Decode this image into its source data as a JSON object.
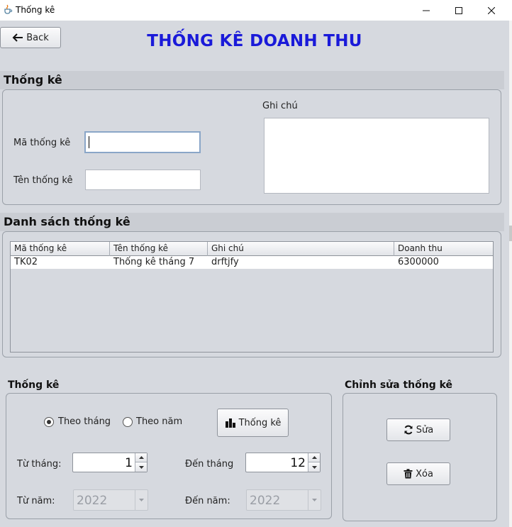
{
  "window": {
    "title": "Thống kê",
    "icon": "java-cup-icon",
    "controls": [
      "minimize-icon",
      "maximize-icon",
      "close-icon"
    ]
  },
  "header": {
    "back_label": "Back",
    "heading": "THỐNG KÊ DOANH THU"
  },
  "form_section": {
    "title": "Thống kê",
    "ma_label": "Mã thống kê",
    "ma_value": "",
    "ten_label": "Tên thống kê",
    "ten_value": "",
    "ghichu_label": "Ghi chú",
    "ghichu_value": ""
  },
  "list_section": {
    "title": "Danh sách thống kê",
    "columns": [
      "Mã thống kê",
      "Tên thống kê",
      "Ghi chú",
      "Doanh thu"
    ],
    "rows": [
      [
        "TK02",
        "Thống kê tháng 7",
        "drftjfy",
        "6300000"
      ]
    ]
  },
  "stats_section": {
    "title": "Thống kê",
    "radio_month": "Theo tháng",
    "radio_year": "Theo năm",
    "selected": "Theo tháng",
    "run_button": "Thống kê",
    "from_month_label": "Từ tháng:",
    "from_month_value": "1",
    "to_month_label": "Đến tháng",
    "to_month_value": "12",
    "from_year_label": "Từ năm:",
    "from_year_value": "2022",
    "to_year_label": "Đến năm:",
    "to_year_value": "2022"
  },
  "edit_section": {
    "title": "Chỉnh sửa thống kê",
    "edit_button": "Sửa",
    "delete_button": "Xóa"
  },
  "colors": {
    "heading": "#1a1ad9",
    "background": "#d6d9df"
  }
}
